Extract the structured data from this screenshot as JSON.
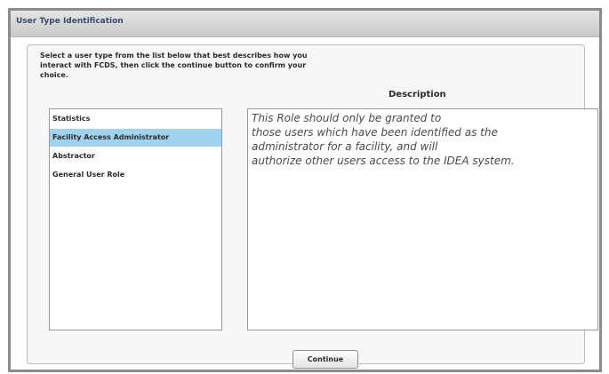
{
  "window": {
    "title": "User Type Identification"
  },
  "instructions": {
    "lines": [
      "Select a user type from the list below that best describes how you",
      "interact with FCDS, then click the continue button to confirm your",
      "choice."
    ]
  },
  "list": {
    "items": [
      {
        "label": "Statistics",
        "selected": false
      },
      {
        "label": "Facility Access Administrator",
        "selected": true
      },
      {
        "label": "Abstractor",
        "selected": false
      },
      {
        "label": "General User Role",
        "selected": false
      }
    ]
  },
  "description": {
    "heading": "Description",
    "lines": [
      "This Role should only be granted to",
      "those users which have been identified as the",
      "administrator for a facility, and will",
      "authorize other users access to the IDEA system."
    ]
  },
  "actions": {
    "continue_label": "Continue"
  },
  "colors": {
    "selection": "#9fd3ef",
    "title_text": "#3a4a6a"
  }
}
